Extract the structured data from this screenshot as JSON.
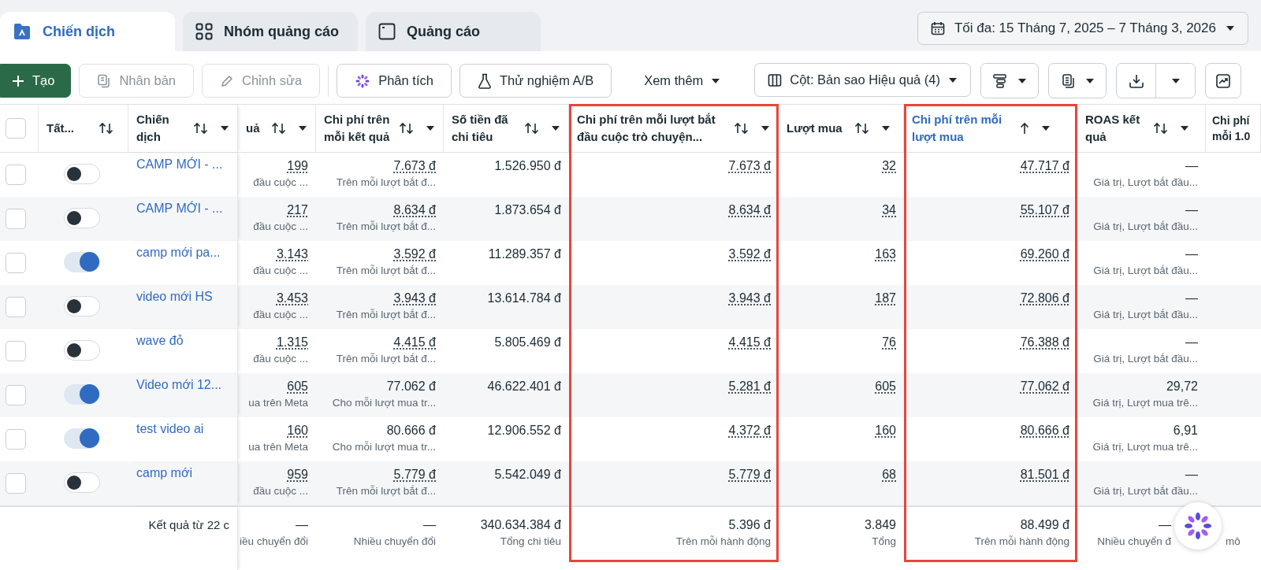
{
  "tabs": [
    {
      "label": "Chiến dịch",
      "selected": true
    },
    {
      "label": "Nhóm quảng cáo",
      "selected": false
    },
    {
      "label": "Quảng cáo",
      "selected": false
    }
  ],
  "date_range": "Tối đa: 15 Tháng 7, 2025 – 7 Tháng 3, 2026",
  "toolbar_left": [
    {
      "label": "Tạo",
      "kind": "primary",
      "disabled": false
    },
    {
      "label": "Nhân bản",
      "kind": "button",
      "disabled": true
    },
    {
      "label": "Chỉnh sửa",
      "kind": "button",
      "disabled": true
    },
    {
      "label": "Phân tích",
      "kind": "button",
      "disabled": false
    },
    {
      "label": "Thử nghiệm A/B",
      "kind": "button",
      "disabled": false
    },
    {
      "label": "Xem thêm",
      "kind": "menu",
      "disabled": false
    }
  ],
  "columns_button": "Cột: Bản sao Hiệu quả (4)",
  "table": {
    "header_checked": false,
    "fixed_columns": [
      {
        "label": "Tất...",
        "sortable": true,
        "menu": false
      },
      {
        "label": "Chiến dịch",
        "sortable": true,
        "menu": true
      }
    ],
    "columns": [
      {
        "label": "uả",
        "sortable": true,
        "sorted": false,
        "menu": true,
        "highlighted": false
      },
      {
        "label": "Chi phí trên mỗi kết quả",
        "sortable": true,
        "sorted": false,
        "menu": true,
        "highlighted": false
      },
      {
        "label": "Số tiền đã chi tiêu",
        "sortable": true,
        "sorted": false,
        "menu": true,
        "highlighted": false
      },
      {
        "label": "Chi phí trên mỗi lượt bắt đầu cuộc trò chuyện...",
        "sortable": true,
        "sorted": false,
        "menu": true,
        "highlighted": true
      },
      {
        "label": "Lượt mua",
        "sortable": true,
        "sorted": false,
        "menu": true,
        "highlighted": false
      },
      {
        "label": "Chi phí trên mỗi lượt mua",
        "sortable": true,
        "sorted": true,
        "menu": true,
        "highlighted": true
      },
      {
        "label": "ROAS kết quả",
        "sortable": true,
        "sorted": false,
        "menu": true,
        "highlighted": false
      },
      {
        "label": "Chi phí mỗi 1.0",
        "sortable": false,
        "sorted": false,
        "menu": false,
        "highlighted": false
      }
    ],
    "rows": [
      {
        "checked": false,
        "on": false,
        "name": "CAMP MỚI - ...",
        "cells": [
          {
            "value": "199",
            "note": "đầu cuộc ...",
            "dotted": true
          },
          {
            "value": "7.673 đ",
            "note": "Trên mỗi lượt bắt đ...",
            "dotted": true
          },
          {
            "value": "1.526.950 đ",
            "dotted": false
          },
          {
            "value": "7.673 đ",
            "dotted": true
          },
          {
            "value": "32",
            "dotted": true
          },
          {
            "value": "47.717 đ",
            "dotted": true
          },
          {
            "value": "—",
            "note": "Giá trị, Lượt bắt đầu...",
            "dotted": false
          }
        ]
      },
      {
        "checked": false,
        "on": false,
        "name": "CAMP MỚI - ...",
        "cells": [
          {
            "value": "217",
            "note": "đầu cuộc ...",
            "dotted": true
          },
          {
            "value": "8.634 đ",
            "note": "Trên mỗi lượt bắt đ...",
            "dotted": true
          },
          {
            "value": "1.873.654 đ",
            "dotted": false
          },
          {
            "value": "8.634 đ",
            "dotted": true
          },
          {
            "value": "34",
            "dotted": true
          },
          {
            "value": "55.107 đ",
            "dotted": true
          },
          {
            "value": "—",
            "note": "Giá trị, Lượt bắt đầu...",
            "dotted": false
          }
        ]
      },
      {
        "checked": false,
        "on": true,
        "name": "camp mới pa...",
        "cells": [
          {
            "value": "3.143",
            "note": "đầu cuộc ...",
            "dotted": true
          },
          {
            "value": "3.592 đ",
            "note": "Trên mỗi lượt bắt đ...",
            "dotted": true
          },
          {
            "value": "11.289.357 đ",
            "dotted": false
          },
          {
            "value": "3.592 đ",
            "dotted": true
          },
          {
            "value": "163",
            "dotted": true
          },
          {
            "value": "69.260 đ",
            "dotted": true
          },
          {
            "value": "—",
            "note": "Giá trị, Lượt bắt đầu...",
            "dotted": false
          }
        ]
      },
      {
        "checked": false,
        "on": false,
        "name": "video mới HS",
        "cells": [
          {
            "value": "3.453",
            "note": "đầu cuộc ...",
            "dotted": true
          },
          {
            "value": "3.943 đ",
            "note": "Trên mỗi lượt bắt đ...",
            "dotted": true
          },
          {
            "value": "13.614.784 đ",
            "dotted": false
          },
          {
            "value": "3.943 đ",
            "dotted": true
          },
          {
            "value": "187",
            "dotted": true
          },
          {
            "value": "72.806 đ",
            "dotted": true
          },
          {
            "value": "—",
            "note": "Giá trị, Lượt bắt đầu...",
            "dotted": false
          }
        ]
      },
      {
        "checked": false,
        "on": false,
        "name": "wave đỏ",
        "cells": [
          {
            "value": "1.315",
            "note": "đầu cuộc ...",
            "dotted": true
          },
          {
            "value": "4.415 đ",
            "note": "Trên mỗi lượt bắt đ...",
            "dotted": true
          },
          {
            "value": "5.805.469 đ",
            "dotted": false
          },
          {
            "value": "4.415 đ",
            "dotted": true
          },
          {
            "value": "76",
            "dotted": true
          },
          {
            "value": "76.388 đ",
            "dotted": true
          },
          {
            "value": "—",
            "note": "Giá trị, Lượt bắt đầu...",
            "dotted": false
          }
        ]
      },
      {
        "checked": false,
        "on": true,
        "name": "Video mới 12...",
        "cells": [
          {
            "value": "605",
            "note": "ua trên Meta",
            "dotted": true
          },
          {
            "value": "77.062 đ",
            "note": "Cho mỗi lượt mua tr...",
            "dotted": false
          },
          {
            "value": "46.622.401 đ",
            "dotted": false
          },
          {
            "value": "5.281 đ",
            "dotted": true
          },
          {
            "value": "605",
            "dotted": true
          },
          {
            "value": "77.062 đ",
            "dotted": true
          },
          {
            "value": "29,72",
            "note": "Giá trị, Lượt mua trê...",
            "dotted": false
          }
        ]
      },
      {
        "checked": false,
        "on": true,
        "name": "test video ai",
        "cells": [
          {
            "value": "160",
            "note": "ua trên Meta",
            "dotted": true
          },
          {
            "value": "80.666 đ",
            "note": "Cho mỗi lượt mua tr...",
            "dotted": false
          },
          {
            "value": "12.906.552 đ",
            "dotted": false
          },
          {
            "value": "4.372 đ",
            "dotted": true
          },
          {
            "value": "160",
            "dotted": true
          },
          {
            "value": "80.666 đ",
            "dotted": true
          },
          {
            "value": "6,91",
            "note": "Giá trị, Lượt mua trê...",
            "dotted": false
          }
        ]
      },
      {
        "checked": false,
        "on": false,
        "name": "camp mới",
        "cells": [
          {
            "value": "959",
            "note": "đầu cuộc ...",
            "dotted": true
          },
          {
            "value": "5.779 đ",
            "note": "Trên mỗi lượt bắt đ...",
            "dotted": true
          },
          {
            "value": "5.542.049 đ",
            "dotted": false
          },
          {
            "value": "5.779 đ",
            "dotted": true
          },
          {
            "value": "68",
            "dotted": true
          },
          {
            "value": "81.501 đ",
            "dotted": true
          },
          {
            "value": "—",
            "note": "Giá trị, Lượt bắt đầu...",
            "dotted": false
          }
        ]
      }
    ],
    "footer": {
      "label": "Kết quả từ 22 c",
      "cells": [
        {
          "value": "—",
          "note": "iều chuyển đổi"
        },
        {
          "value": "—",
          "note": "Nhiều chuyển đổi"
        },
        {
          "value": "340.634.384 đ",
          "note": "Tổng chi tiêu"
        },
        {
          "value": "5.396 đ",
          "note": "Trên mỗi hành động"
        },
        {
          "value": "3.849",
          "note": "Tổng"
        },
        {
          "value": "88.499 đ",
          "note": "Trên mỗi hành động"
        },
        {
          "value": "—",
          "note": "Nhiều chuyển đ"
        },
        {
          "note": "mô"
        }
      ]
    }
  }
}
